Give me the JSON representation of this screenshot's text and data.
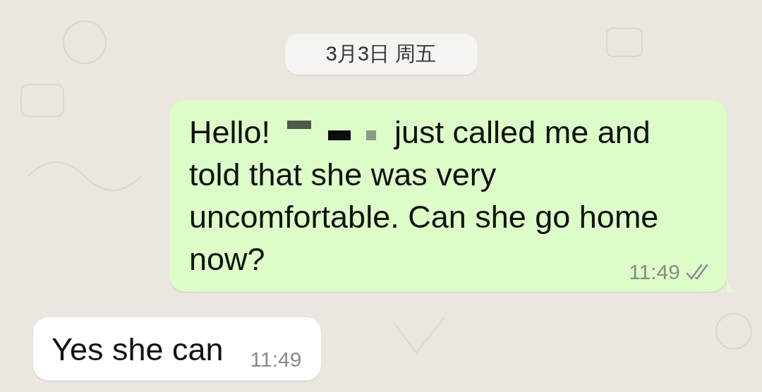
{
  "date_divider": "3月3日 周五",
  "messages": [
    {
      "kind": "outgoing",
      "greeting": "Hello!",
      "redacted": true,
      "text_lines": [
        "just called me and",
        "told that she was very",
        "uncomfortable. Can she go home",
        "now?"
      ],
      "time": "11:49",
      "read": true
    },
    {
      "kind": "incoming",
      "text_lines": [
        "Yes she can"
      ],
      "time": "11:49"
    }
  ]
}
